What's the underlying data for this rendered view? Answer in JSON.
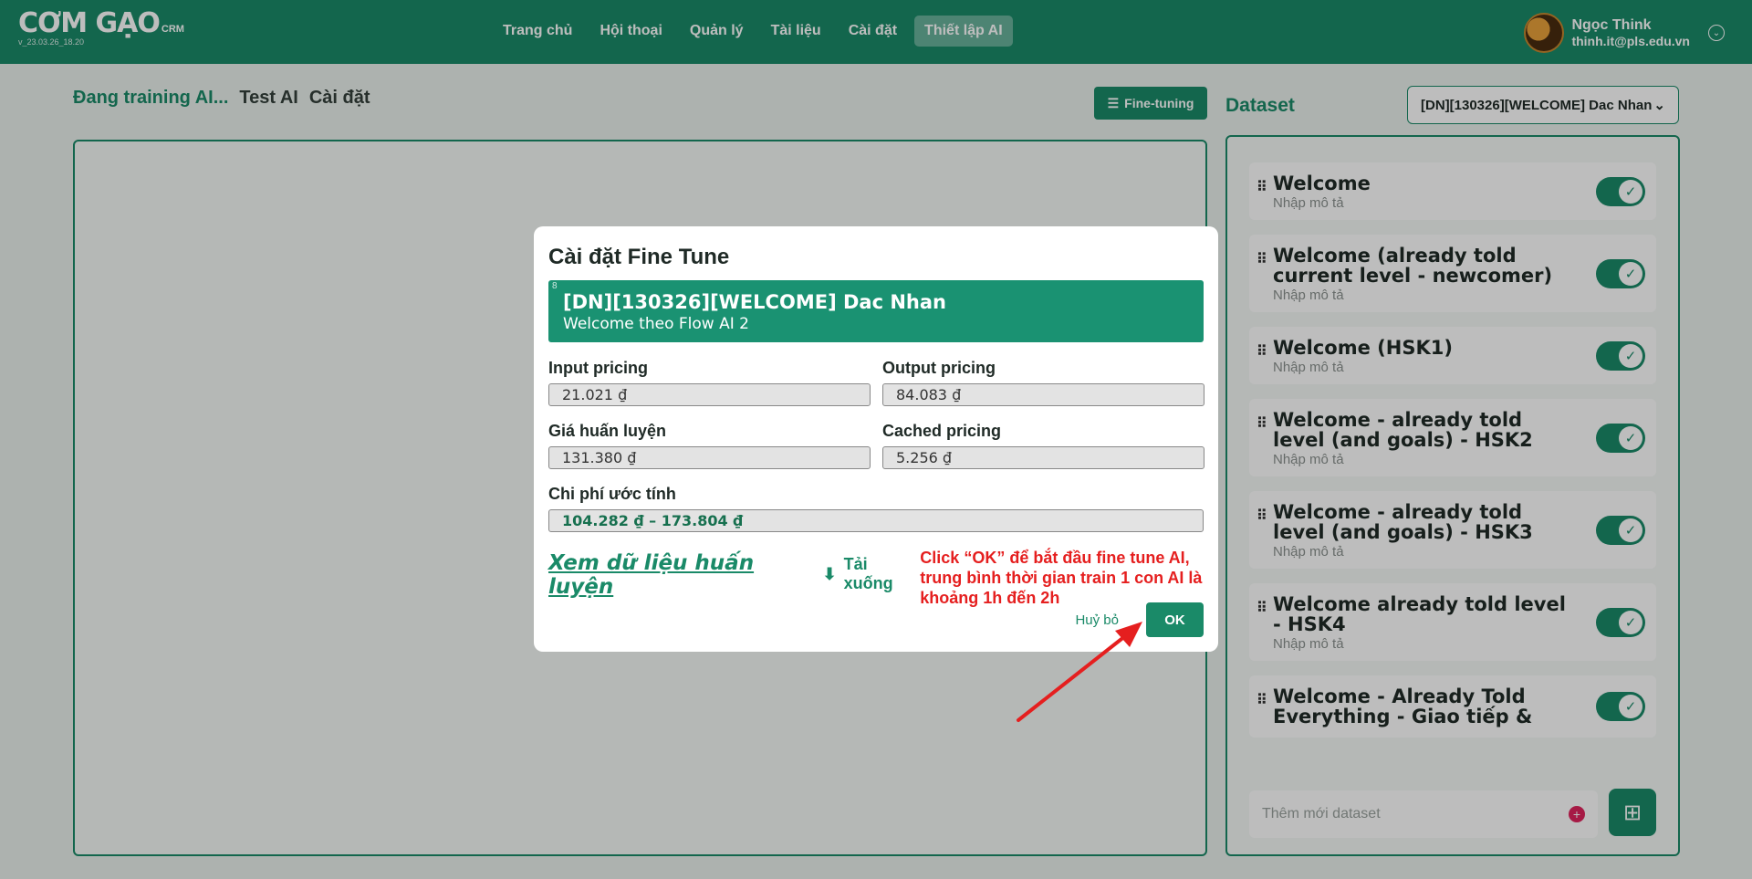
{
  "app": {
    "logo": "CƠM GẠO",
    "logo_suffix": "CRM",
    "version": "v_23.03.26_18.20"
  },
  "nav": {
    "items": [
      "Trang chủ",
      "Hội thoại",
      "Quản lý",
      "Tài liệu",
      "Cài đặt",
      "Thiết lập AI"
    ],
    "active": "Thiết lập AI"
  },
  "user": {
    "name": "Ngọc Think",
    "email": "thinh.it@pls.edu.vn"
  },
  "left": {
    "tabs": [
      "Đang training AI...",
      "Test AI",
      "Cài đặt"
    ],
    "finetune_label": "Fine-tuning"
  },
  "dataset": {
    "title": "Dataset",
    "selected": "[DN][130326][WELCOME] Dac Nhan",
    "items": [
      {
        "name": "Welcome",
        "desc": "Nhập mô tả",
        "enabled": true
      },
      {
        "name": "Welcome (already told current level - newcomer)",
        "desc": "Nhập mô tả",
        "enabled": true
      },
      {
        "name": "Welcome (HSK1)",
        "desc": "Nhập mô tả",
        "enabled": true
      },
      {
        "name": "Welcome - already told level (and goals) - HSK2",
        "desc": "Nhập mô tả",
        "enabled": true
      },
      {
        "name": "Welcome - already told level (and goals) - HSK3",
        "desc": "Nhập mô tả",
        "enabled": true
      },
      {
        "name": "Welcome already told level - HSK4",
        "desc": "Nhập mô tả",
        "enabled": true
      },
      {
        "name": "Welcome - Already Told Everything - Giao tiếp &",
        "desc": "",
        "enabled": true
      }
    ],
    "add_placeholder": "Thêm mới dataset"
  },
  "modal": {
    "title": "Cài đặt Fine Tune",
    "model_name": "[DN][130326][WELCOME] Dac Nhan",
    "model_sub": "Welcome theo Flow AI 2",
    "model_small": "8",
    "input_label": "Input pricing",
    "input_value": "21.021 ₫",
    "output_label": "Output pricing",
    "output_value": "84.083 ₫",
    "training_label": "Giá huấn luyện",
    "training_value": "131.380 ₫",
    "cached_label": "Cached pricing",
    "cached_value": "5.256 ₫",
    "estimate_label": "Chi phí ước tính",
    "estimate_value": "104.282 ₫ – 173.804 ₫",
    "view_link": "Xem dữ liệu huấn luyện",
    "download_label": "Tải xuống",
    "note": "Click “OK” để bắt đầu fine tune AI, trung bình thời gian train 1 con AI là khoảng 1h đến 2h",
    "cancel": "Huỷ bỏ",
    "ok": "OK"
  },
  "colors": {
    "brand": "#1a8a68",
    "annotation": "#e51f1f"
  }
}
